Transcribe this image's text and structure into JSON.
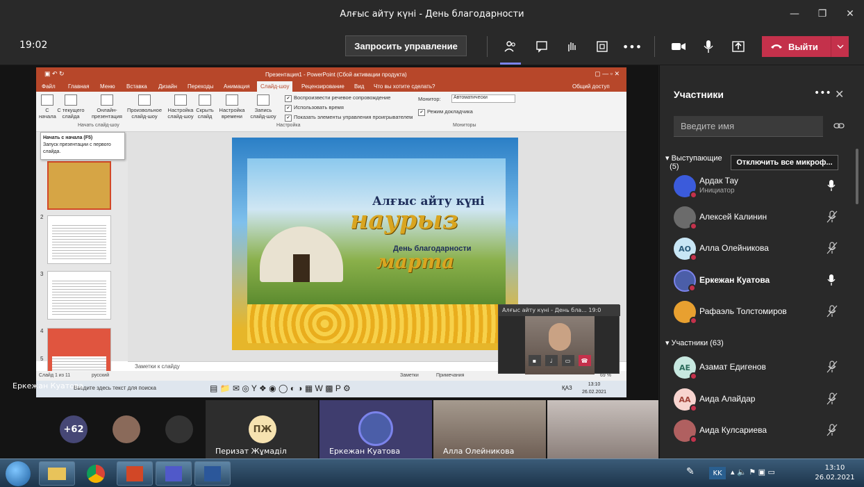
{
  "window": {
    "title": "Алғыс айту күні - День благодарности"
  },
  "toolbar": {
    "clock": "19:02",
    "request_control": "Запросить управление",
    "leave_label": "Выйти"
  },
  "ppt": {
    "title": "Презентация1 - PowerPoint (Сбой активации продукта)",
    "tabs": [
      "Файл",
      "Главная",
      "Меню",
      "Вставка",
      "Дизайн",
      "Переходы",
      "Анимация",
      "Слайд-шоу",
      "Рецензирование",
      "Вид",
      "Что вы хотите сделать?"
    ],
    "share": "Общий доступ",
    "ribbon_buttons": [
      "С начала",
      "С текущего слайда",
      "Онлайн-презентация",
      "Произвольное слайд-шоу",
      "Настройка слайд-шоу",
      "Скрыть слайд",
      "Настройка времени",
      "Запись слайд-шоу"
    ],
    "group_start": "Начать слайд-шоу",
    "group_setup": "Настройка",
    "group_monitors": "Мониторы",
    "checks": [
      "Воспроизвести речевое сопровождение",
      "Использовать время",
      "Показать элементы управления проигрывателем"
    ],
    "monitor_label": "Монитор:",
    "monitor_value": "Автоматически",
    "presenter_mode": "Режим докладчика",
    "tooltip_title": "Начать с начала (F5)",
    "tooltip_text": "Запуск презентации с первого слайда.",
    "thumb_numbers": [
      "2",
      "3",
      "4",
      "5"
    ],
    "notes_placeholder": "Заметки к слайду",
    "status_left": "Слайд 1 из 11",
    "status_lang": "русский",
    "status_notes": "Заметки",
    "status_comments": "Примечания",
    "zoom": "69 %",
    "search_placeholder": "Введите здесь текст для поиска",
    "inner_lang": "ҚАЗ",
    "inner_time": "13:10",
    "inner_date": "26.02.2021",
    "slide_line1": "Алғыс айту күні",
    "slide_line2": "наурыз",
    "slide_line3": "День благодарности",
    "slide_line4": "марта"
  },
  "selfview": {
    "title": "Алғыс айту күні - День бла...",
    "timer": "19:0"
  },
  "presenter_name": "Еркежан Куатова",
  "gallery": {
    "overflow": "+62",
    "tiles": [
      {
        "initials": "ПЖ",
        "name": "Перизат Жұмаділ"
      },
      {
        "name": "Еркежан Куатова"
      },
      {
        "name": "Алла Олейникова"
      }
    ]
  },
  "panel": {
    "title": "Участники",
    "search_placeholder": "Введите имя",
    "presenters_header": "Выступающие",
    "presenters_count": "(5)",
    "mute_all": "Отключить все микроф...",
    "attendees_header": "Участники (63)",
    "presenters": [
      {
        "name": "Ардак Тау",
        "role": "Инициатор",
        "avatar_color": "#3b5bdb",
        "mic": "on"
      },
      {
        "name": "Алексей Калинин",
        "avatar_color": "#6b6b6b",
        "mic": "off"
      },
      {
        "name": "Алла Олейникова",
        "initials": "АО",
        "avatar_color": "#c8e6f5",
        "mic": "off"
      },
      {
        "name": "Еркежан Куатова",
        "avatar_color": "#4b5ea8",
        "mic": "on"
      },
      {
        "name": "Рафаэль Толстомиров",
        "avatar_color": "#e8a030",
        "mic": "off"
      }
    ],
    "attendees": [
      {
        "name": "Азамат Едигенов",
        "initials": "АЕ",
        "avatar_color": "#c7e8e0",
        "mic": "off"
      },
      {
        "name": "Аида Алайдар",
        "initials": "АА",
        "avatar_color": "#f7d4cf",
        "mic": "off"
      },
      {
        "name": "Аида Кулсариева",
        "avatar_color": "#b06060",
        "mic": "off"
      }
    ]
  },
  "taskbar": {
    "lang": "KK",
    "time": "13:10",
    "date": "26.02.2021"
  },
  "colors": {
    "leave": "#c4314b",
    "accent": "#7b83eb",
    "ppt": "#b7472a"
  }
}
